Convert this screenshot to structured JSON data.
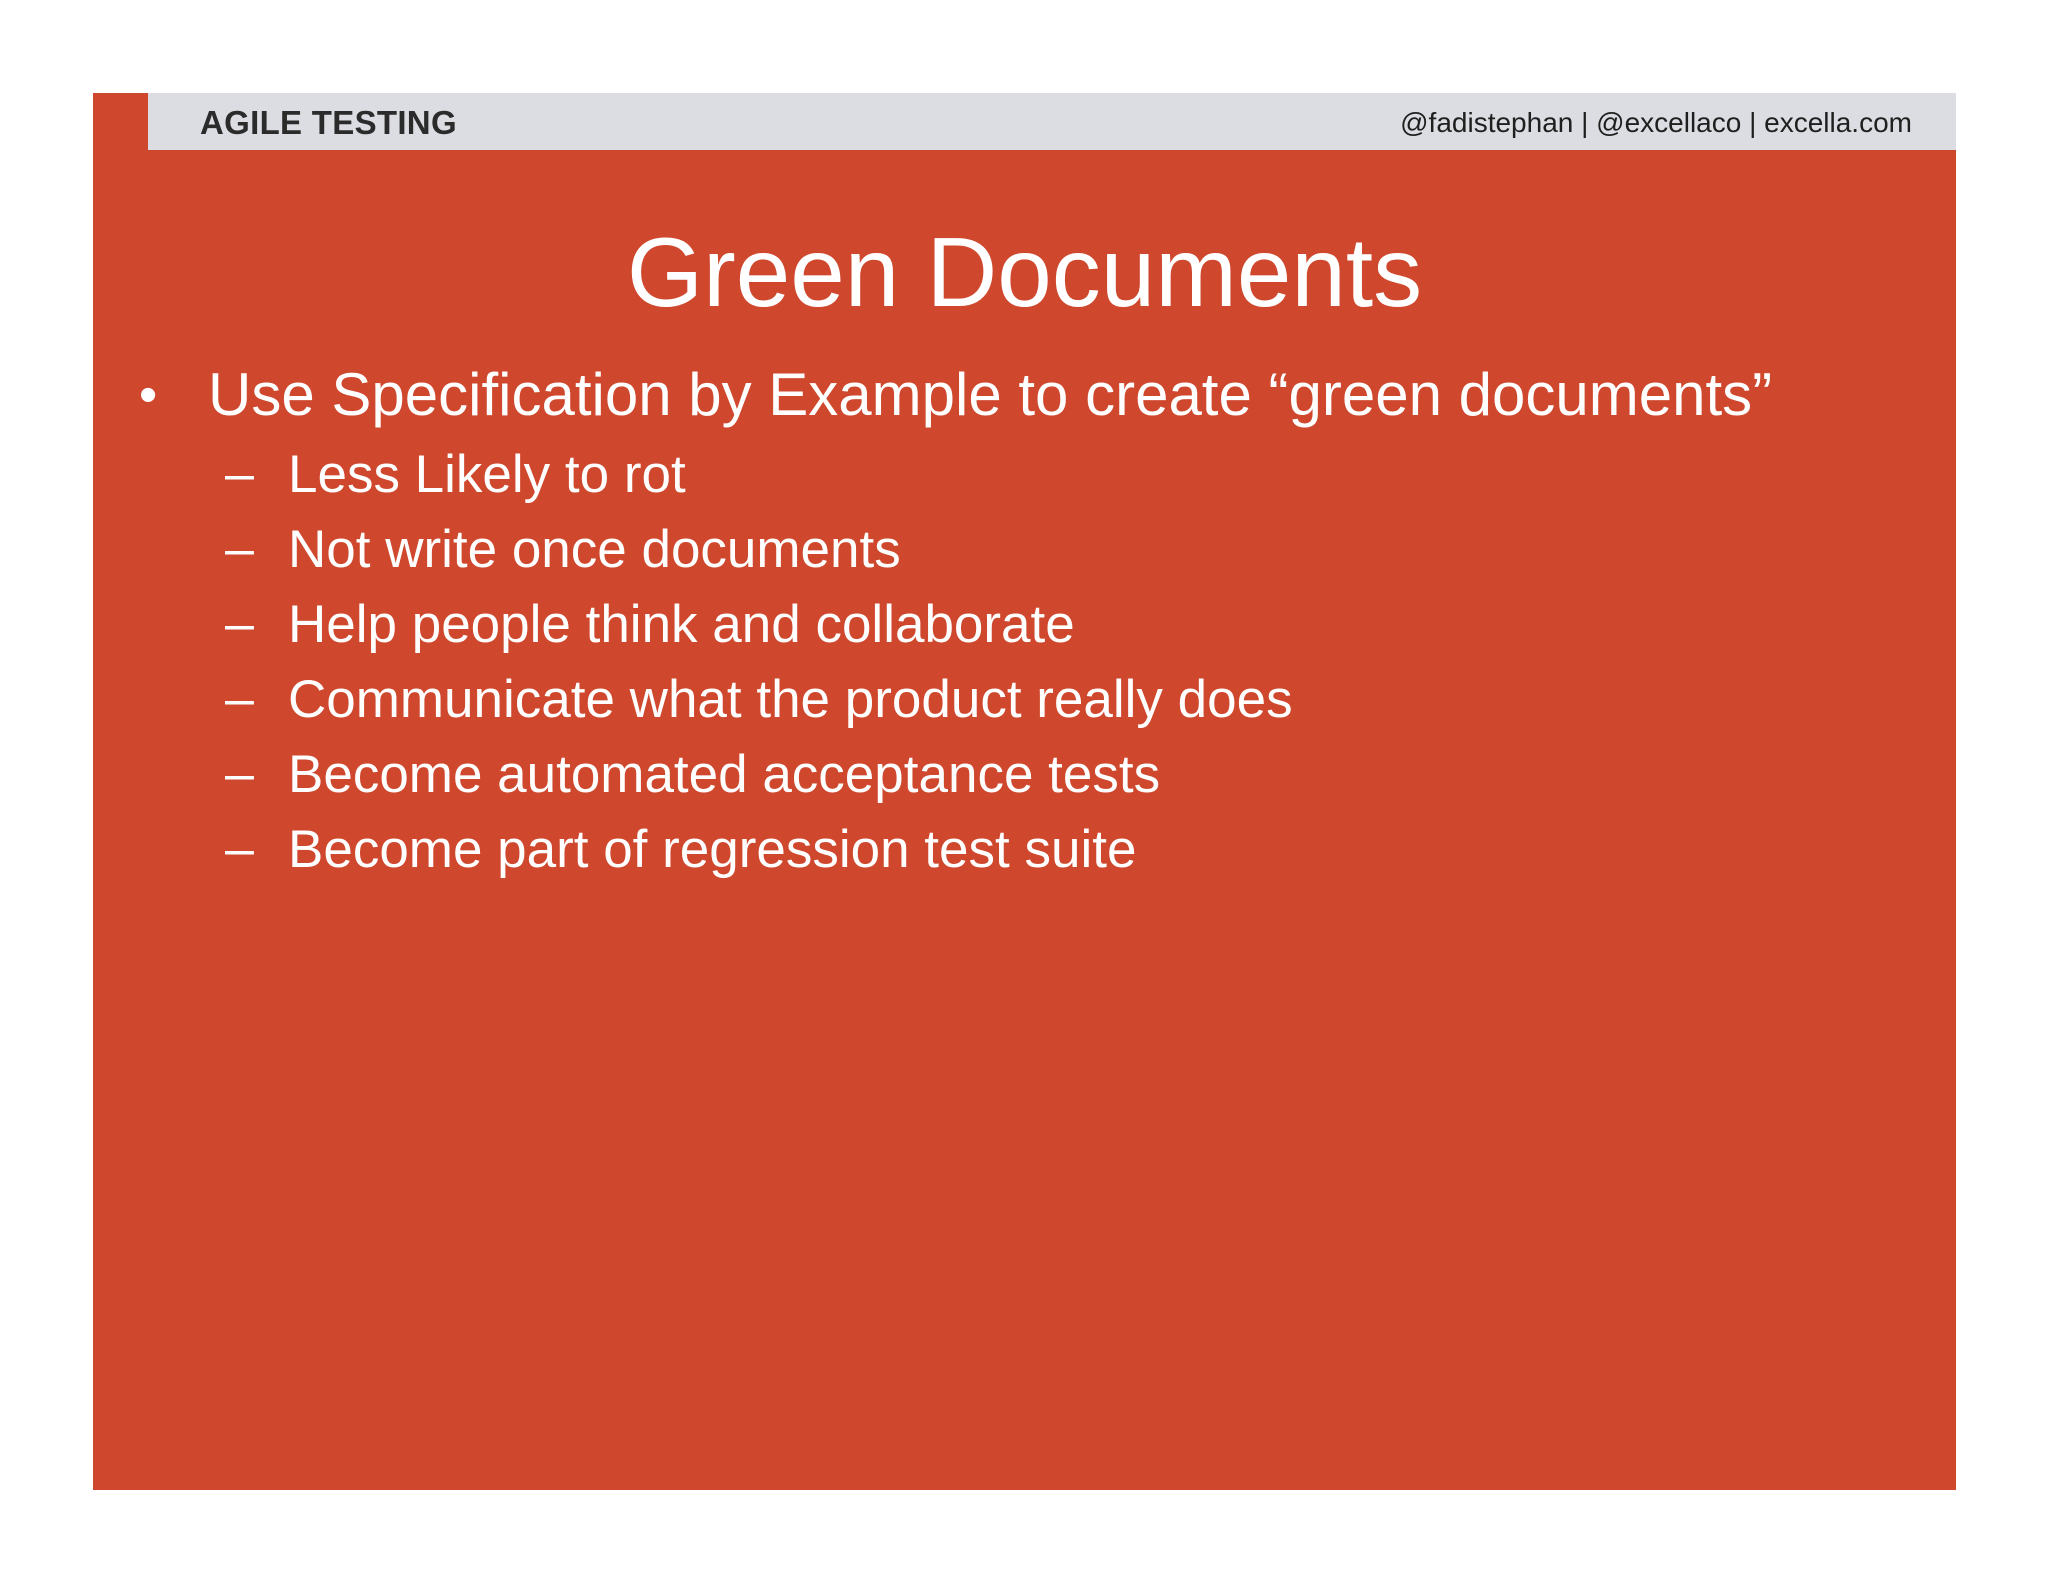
{
  "header": {
    "left_label": "AGILE TESTING",
    "right_label": "@fadistephan | @excellaco | excella.com"
  },
  "slide": {
    "title": "Green Documents",
    "bullet": {
      "marker": "•",
      "text": "Use Specification by Example to create “green documents”"
    },
    "sub_marker": "–",
    "sub_items": [
      "Less Likely to rot",
      "Not write once documents",
      "Help people think and collaborate",
      "Communicate what the product really does",
      "Become automated acceptance tests",
      "Become part of regression test suite"
    ]
  },
  "colors": {
    "slide_background": "#cf472c",
    "header_bar": "#dcdde2",
    "text": "#ffffff"
  }
}
